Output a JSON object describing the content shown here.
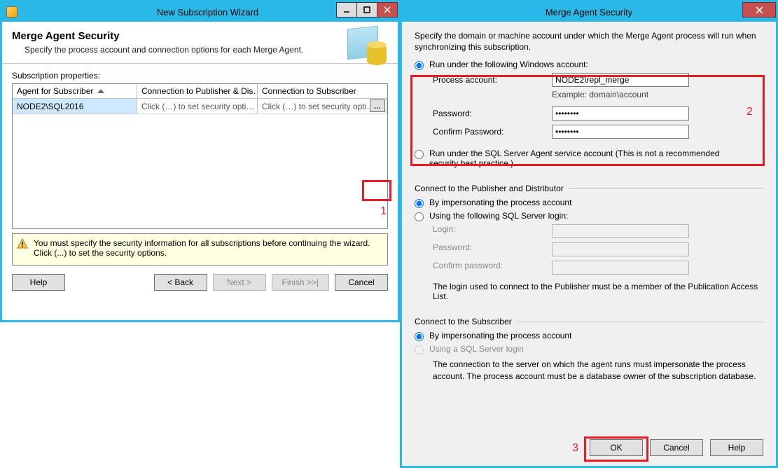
{
  "left": {
    "window_title": "New Subscription Wizard",
    "heading": "Merge Agent Security",
    "subheading": "Specify the process account and connection options for each Merge Agent.",
    "subprops_label": "Subscription properties:",
    "grid": {
      "headers": {
        "agent": "Agent for Subscriber",
        "pubdist": "Connection to Publisher & Dis…",
        "subscriber": "Connection to Subscriber"
      },
      "row": {
        "agent": "NODE2\\SQL2016",
        "pubdist": "Click (…) to set security opti…",
        "subscriber": "Click (…) to set security opti…",
        "ellipsis_label": "..."
      }
    },
    "warning": "You must specify the security information for all subscriptions before continuing the wizard. Click (...) to set the security options.",
    "buttons": {
      "help": "Help",
      "back": "< Back",
      "next": "Next >",
      "finish": "Finish >>|",
      "cancel": "Cancel"
    },
    "markers": {
      "one": "1"
    }
  },
  "right": {
    "window_title": "Merge Agent Security",
    "intro": "Specify the domain or machine account under which the Merge Agent process will run when synchronizing this subscription.",
    "opt_windows": "Run under the following Windows account:",
    "process_account_label": "Process account:",
    "process_account_value": "NODE2\\repl_merge",
    "example": "Example: domain\\account",
    "password_label": "Password:",
    "password_value": "********",
    "confirm_label": "Confirm Password:",
    "confirm_value": "********",
    "opt_agent": "Run under the SQL Server Agent service account (This is not a recommended security best practice.)",
    "pubdist_header": "Connect to the Publisher and Distributor",
    "pub_opt_impersonate": "By impersonating the process account",
    "pub_opt_sql": "Using the following SQL Server login:",
    "pub_login_label": "Login:",
    "pub_password_label": "Password:",
    "pub_confirm_label": "Confirm password:",
    "pub_note": "The login used to connect to the Publisher must be a member of the Publication Access List.",
    "sub_header": "Connect to the Subscriber",
    "sub_opt_impersonate": "By impersonating the process account",
    "sub_opt_sql": "Using a SQL Server login",
    "sub_note": "The connection to the server on which the agent runs must impersonate the process account. The process account must be a database owner of the subscription database.",
    "buttons": {
      "ok": "OK",
      "cancel": "Cancel",
      "help": "Help"
    },
    "markers": {
      "two": "2",
      "three": "3"
    }
  }
}
